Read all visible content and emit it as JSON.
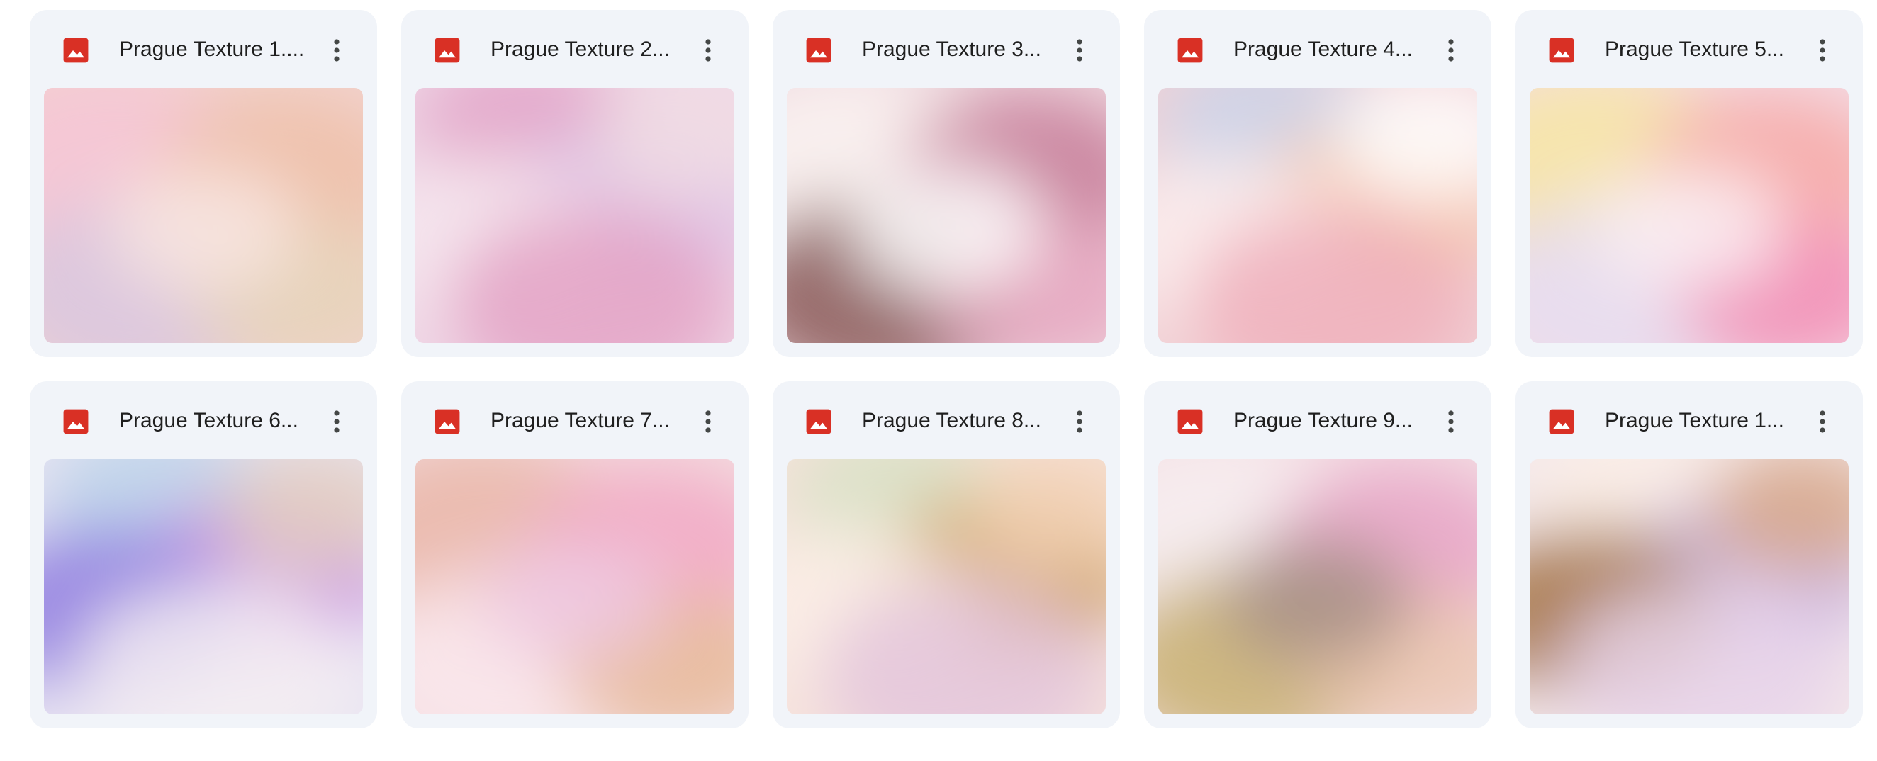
{
  "files": [
    {
      "name": "Prague Texture 1....",
      "icon": "image-file-icon",
      "thumbnail": {
        "base": "#f2d3cf",
        "blobs": [
          "#f6c6d6",
          "#efc0a8",
          "#d9c7e0",
          "#e6d4b8",
          "#f9e6e0"
        ]
      }
    },
    {
      "name": "Prague Texture 2...",
      "icon": "image-file-icon",
      "thumbnail": {
        "base": "#efd7e6",
        "blobs": [
          "#e3a3c8",
          "#dcc0e6",
          "#f6e6ef",
          "#e4a3c6",
          "#f1dde4"
        ]
      }
    },
    {
      "name": "Prague Texture 3...",
      "icon": "image-file-icon",
      "thumbnail": {
        "base": "#efd8df",
        "blobs": [
          "#faf3f1",
          "#c77b98",
          "#8a5a58",
          "#e6a6c0",
          "#ffffff"
        ]
      }
    },
    {
      "name": "Prague Texture 4...",
      "icon": "image-file-icon",
      "thumbnail": {
        "base": "#f1d2d6",
        "blobs": [
          "#c9d3ea",
          "#f7c4a6",
          "#fbeeee",
          "#f0b0bc",
          "#ffffff"
        ]
      }
    },
    {
      "name": "Prague Texture 5...",
      "icon": "image-file-icon",
      "thumbnail": {
        "base": "#f4dde6",
        "blobs": [
          "#f7e6a3",
          "#f7a8a6",
          "#e6ddf0",
          "#f28cb4",
          "#fbeef2"
        ]
      }
    },
    {
      "name": "Prague Texture 6...",
      "icon": "image-file-icon",
      "thumbnail": {
        "base": "#e8e4f2",
        "blobs": [
          "#bcd3ea",
          "#c98ee0",
          "#8e7be0",
          "#f4eef2",
          "#e4cfc0"
        ]
      }
    },
    {
      "name": "Prague Texture 7...",
      "icon": "image-file-icon",
      "thumbnail": {
        "base": "#f3dde0",
        "blobs": [
          "#eab6a8",
          "#f2a8c4",
          "#fae8ec",
          "#e8b898",
          "#efc8e0"
        ]
      }
    },
    {
      "name": "Prague Texture 8...",
      "icon": "image-file-icon",
      "thumbnail": {
        "base": "#f6e3dc",
        "blobs": [
          "#d8e2c6",
          "#c99a50",
          "#fbefe6",
          "#e4c6dc",
          "#f3d3b8"
        ]
      }
    },
    {
      "name": "Prague Texture 9...",
      "icon": "image-file-icon",
      "thumbnail": {
        "base": "#f4dfe4",
        "blobs": [
          "#f7eef0",
          "#e7a3c6",
          "#c8b070",
          "#ebc6b0",
          "#a8908a"
        ]
      }
    },
    {
      "name": "Prague Texture 1...",
      "icon": "image-file-icon",
      "thumbnail": {
        "base": "#f4e8ea",
        "blobs": [
          "#fbefe6",
          "#c9b4e0",
          "#a37240",
          "#e8d3ea",
          "#d8a88a"
        ]
      }
    }
  ],
  "colors": {
    "card_background": "#f1f4f9",
    "title_text": "#1f1f1f",
    "image_icon": "#d93025",
    "more_icon": "#444746"
  }
}
